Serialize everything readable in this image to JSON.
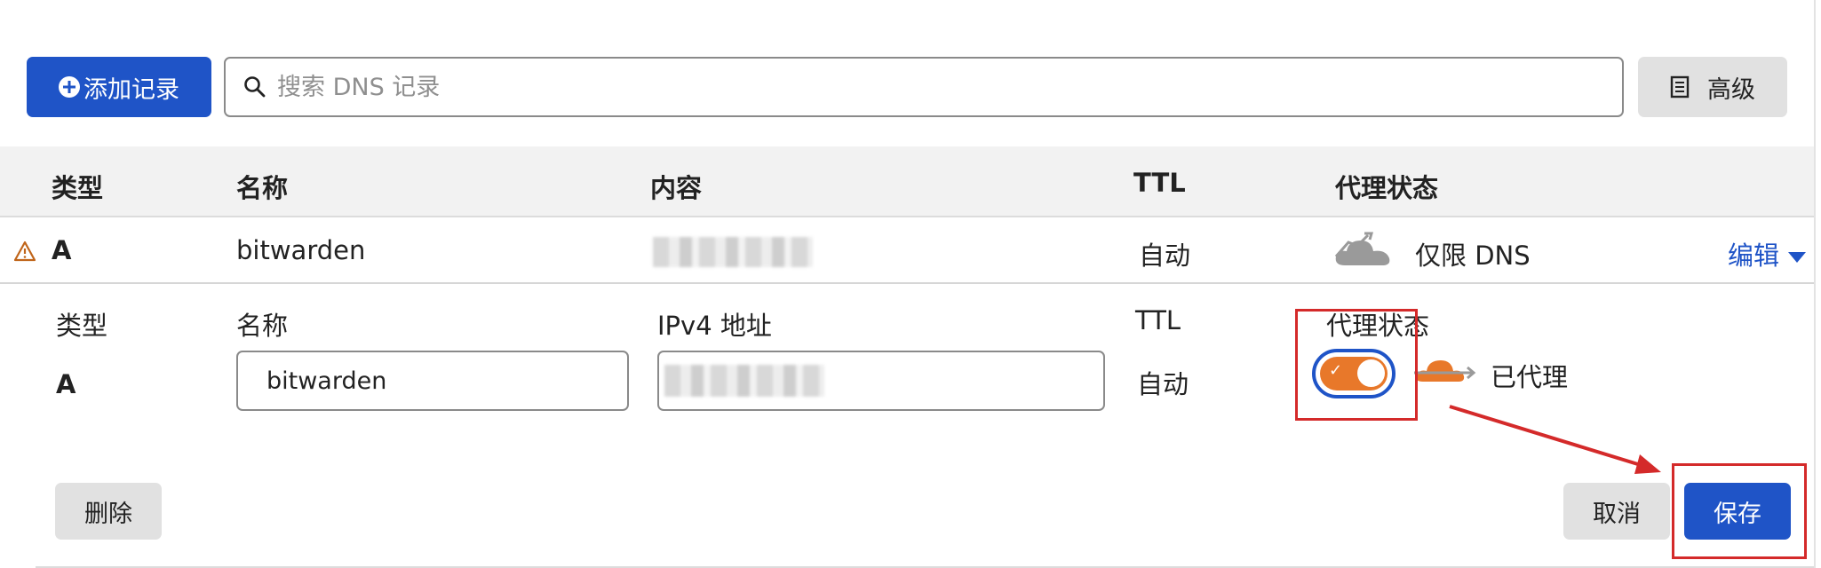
{
  "toolbar": {
    "add_record_label": "添加记录",
    "search_placeholder": "搜索 DNS 记录",
    "advanced_label": "高级"
  },
  "table": {
    "headers": [
      "类型",
      "名称",
      "内容",
      "TTL",
      "代理状态"
    ],
    "row": {
      "type": "A",
      "name": "bitwarden",
      "ttl": "自动",
      "proxy_status": "仅限 DNS",
      "edit_label": "编辑"
    }
  },
  "edit_form": {
    "type_label": "类型",
    "type_value": "A",
    "name_label": "名称",
    "name_value": "bitwarden",
    "ipv4_label": "IPv4 地址",
    "ttl_label": "TTL",
    "ttl_value": "自动",
    "proxy_label": "代理状态",
    "proxy_value": "已代理",
    "proxy_enabled": true
  },
  "actions": {
    "delete_label": "删除",
    "cancel_label": "取消",
    "save_label": "保存"
  },
  "colors": {
    "primary": "#1f54c7",
    "cloud_orange": "#e8782a",
    "cloud_grey": "#9a9a9a",
    "warning": "#c0651a",
    "annotation_red": "#d42a2a"
  },
  "icons": [
    "plus-circle-icon",
    "search-icon",
    "document-icon",
    "warning-icon",
    "cloud-dns-only-icon",
    "chevron-down-icon",
    "cloud-proxied-icon",
    "check-icon"
  ]
}
